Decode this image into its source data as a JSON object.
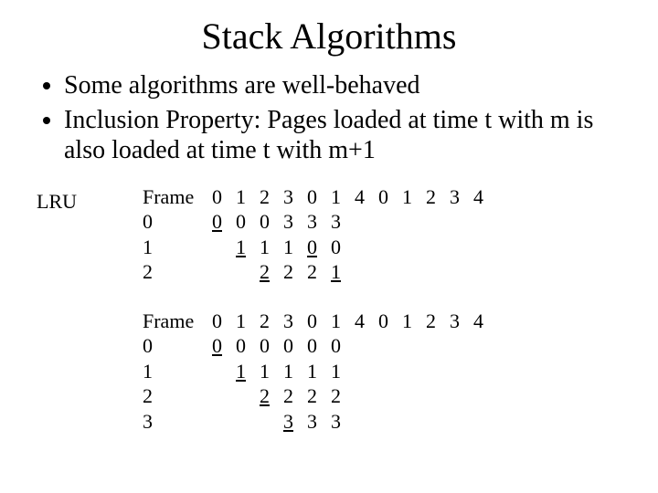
{
  "title": "Stack Algorithms",
  "bullets": [
    "Some algorithms are well-behaved",
    "Inclusion Property: Pages loaded at time t with m is also loaded at time t with m+1"
  ],
  "lru_label": "LRU",
  "tables": [
    {
      "header_label": "Frame",
      "reference_string": [
        "0",
        "1",
        "2",
        "3",
        "0",
        "1",
        "4",
        "0",
        "1",
        "2",
        "3",
        "4"
      ],
      "rows": [
        {
          "label": "0",
          "cells": [
            {
              "v": "0",
              "u": true
            },
            {
              "v": "0"
            },
            {
              "v": "0"
            },
            {
              "v": "3"
            },
            {
              "v": "3"
            },
            {
              "v": "3"
            }
          ]
        },
        {
          "label": "1",
          "cells": [
            {
              "v": ""
            },
            {
              "v": "1",
              "u": true
            },
            {
              "v": "1"
            },
            {
              "v": "1"
            },
            {
              "v": "0",
              "u": true
            },
            {
              "v": "0"
            }
          ]
        },
        {
          "label": "2",
          "cells": [
            {
              "v": ""
            },
            {
              "v": ""
            },
            {
              "v": "2",
              "u": true
            },
            {
              "v": "2"
            },
            {
              "v": "2"
            },
            {
              "v": "1",
              "u": true
            }
          ]
        }
      ]
    },
    {
      "header_label": "Frame",
      "reference_string": [
        "0",
        "1",
        "2",
        "3",
        "0",
        "1",
        "4",
        "0",
        "1",
        "2",
        "3",
        "4"
      ],
      "rows": [
        {
          "label": "0",
          "cells": [
            {
              "v": "0",
              "u": true
            },
            {
              "v": "0"
            },
            {
              "v": "0"
            },
            {
              "v": "0"
            },
            {
              "v": "0"
            },
            {
              "v": "0"
            }
          ]
        },
        {
          "label": "1",
          "cells": [
            {
              "v": ""
            },
            {
              "v": "1",
              "u": true
            },
            {
              "v": "1"
            },
            {
              "v": "1"
            },
            {
              "v": "1"
            },
            {
              "v": "1"
            }
          ]
        },
        {
          "label": "2",
          "cells": [
            {
              "v": ""
            },
            {
              "v": ""
            },
            {
              "v": "2",
              "u": true
            },
            {
              "v": "2"
            },
            {
              "v": "2"
            },
            {
              "v": "2"
            }
          ]
        },
        {
          "label": "3",
          "cells": [
            {
              "v": ""
            },
            {
              "v": ""
            },
            {
              "v": ""
            },
            {
              "v": "3",
              "u": true
            },
            {
              "v": "3"
            },
            {
              "v": "3"
            }
          ]
        }
      ]
    }
  ]
}
